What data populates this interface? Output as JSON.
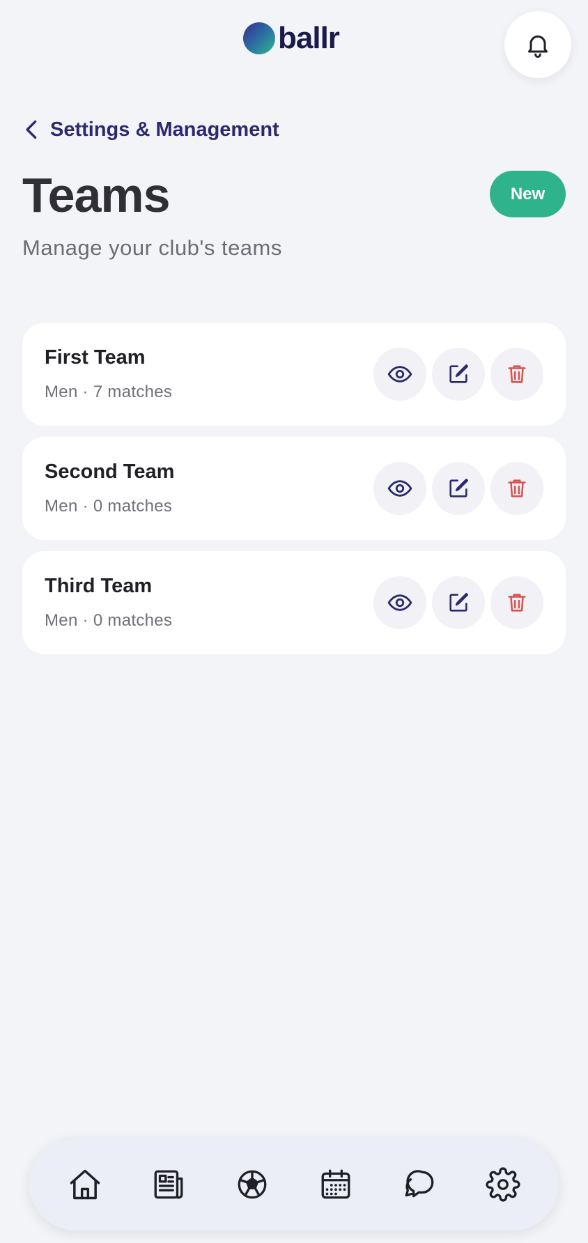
{
  "header": {
    "logo_text": "ballr"
  },
  "breadcrumb": {
    "back_label": "Settings & Management"
  },
  "page": {
    "title": "Teams",
    "subtitle": "Manage your club's teams",
    "new_button_label": "New"
  },
  "teams": [
    {
      "name": "First Team",
      "meta": "Men · 7 matches"
    },
    {
      "name": "Second Team",
      "meta": "Men · 0 matches"
    },
    {
      "name": "Third Team",
      "meta": "Men · 0 matches"
    }
  ],
  "colors": {
    "accent": "#2fb38c",
    "primary": "#2b2a6e",
    "danger": "#d9534f",
    "background": "#f3f4f7"
  },
  "icons": {
    "header": [
      "bell-icon"
    ],
    "actions": [
      "eye-icon",
      "edit-icon",
      "trash-icon"
    ],
    "nav": [
      "home-icon",
      "news-icon",
      "football-icon",
      "calendar-icon",
      "chat-icon",
      "gear-icon"
    ]
  }
}
